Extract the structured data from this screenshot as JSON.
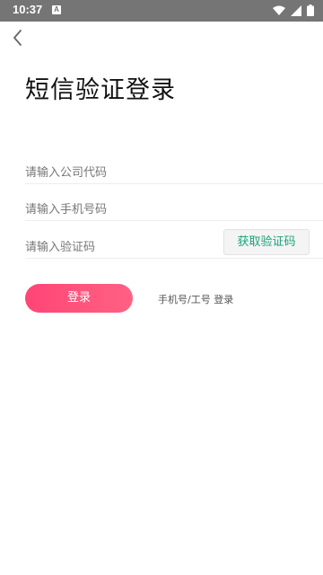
{
  "status_bar": {
    "time": "10:37",
    "notification_letter": "A"
  },
  "page": {
    "title": "短信验证登录"
  },
  "form": {
    "company_code_placeholder": "请输入公司代码",
    "phone_placeholder": "请输入手机号码",
    "code_placeholder": "请输入验证码",
    "get_code_label": "获取验证码"
  },
  "actions": {
    "login_label": "登录",
    "switch_login_label": "手机号/工号 登录"
  },
  "colors": {
    "status_bar": "#757575",
    "login_gradient_start": "#ff4576",
    "login_gradient_end": "#ff6183",
    "get_code_text": "#19a37a"
  }
}
